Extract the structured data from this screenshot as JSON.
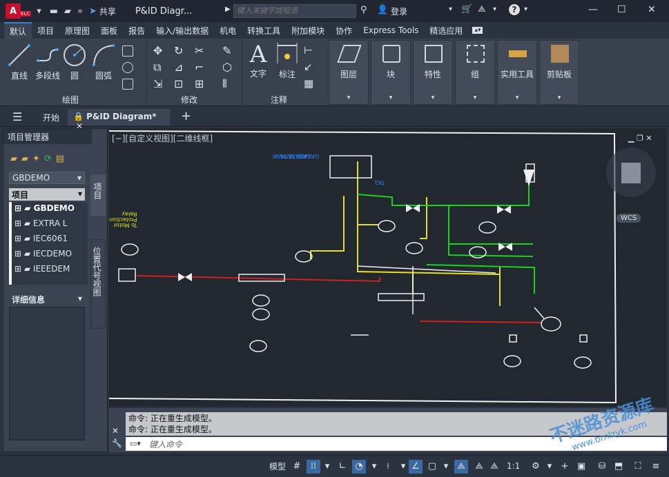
{
  "titlebar": {
    "logo": "A",
    "elc": "ELC",
    "share": "共享",
    "doc_title": "P&ID Diagr...",
    "search_placeholder": "键入关键字或短语",
    "login": "登录"
  },
  "menubar": {
    "items": [
      "默认",
      "项目",
      "原理图",
      "面板",
      "报告",
      "输入/输出数据",
      "机电",
      "转换工具",
      "附加模块",
      "协作",
      "Express Tools",
      "精选应用"
    ]
  },
  "ribbon": {
    "draw": {
      "line": "直线",
      "polyline": "多段线",
      "circle": "圆",
      "arc": "圆弧",
      "label": "绘图"
    },
    "modify": {
      "label": "修改"
    },
    "annotation": {
      "text": "文字",
      "dim": "标注",
      "label": "注释"
    },
    "big": [
      "图层",
      "块",
      "特性",
      "组",
      "实用工具",
      "剪贴板"
    ]
  },
  "tabs": {
    "start": "开始",
    "doc": "P&ID Diagram*"
  },
  "project": {
    "title": "项目管理器",
    "dropdown": "GBDEMO",
    "combo": "项目",
    "items": [
      "GBDEMO",
      "EXTRA L",
      "IEC6061",
      "IECDEMO",
      "IEEEDEM"
    ],
    "details": "详细信息",
    "side_tab1": "项目",
    "side_tab2": "位置代号视图"
  },
  "canvas": {
    "viewport_label": "[−][自定义视图][二维线框]",
    "wcs": "WCS",
    "grease_tank": "GREASE TANK",
    "tk1": "TK1",
    "to_motor": "To Motor\nProtection\nRelay"
  },
  "command": {
    "line1": "命令:   正在重生成模型。",
    "line2": "命令:   正在重生成模型。",
    "placeholder": "键入命令"
  },
  "status": {
    "model": "模型",
    "scale": "1:1"
  },
  "watermark": {
    "text": "不迷路资源库",
    "url": "www.bmlzyk.com"
  }
}
